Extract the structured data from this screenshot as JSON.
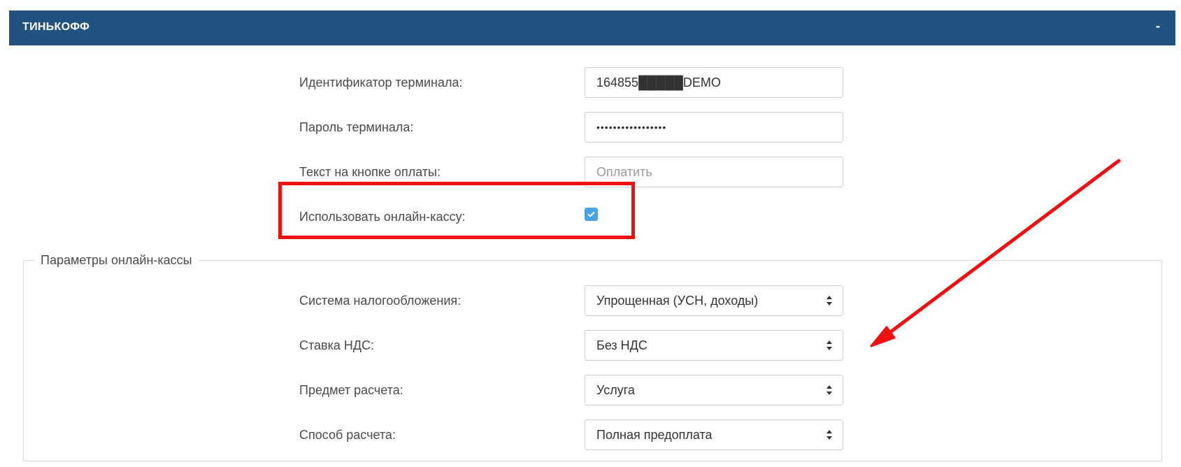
{
  "panel": {
    "title": "ТИНЬКОФФ",
    "toggle_label": "-"
  },
  "terminal": {
    "id_label": "Идентификатор терминала:",
    "id_value": "164855█████DEMO",
    "password_label": "Пароль терминала:",
    "password_value": "•••••••••••••••••",
    "button_text_label": "Текст на кнопке оплаты:",
    "button_text_placeholder": "Оплатить",
    "online_kassa_label": "Использовать онлайн-кассу:",
    "online_kassa_checked": true
  },
  "kassa_params": {
    "legend": "Параметры онлайн-кассы",
    "tax_system_label": "Система налогообложения:",
    "tax_system_value": "Упрощенная (УСН, доходы)",
    "vat_label": "Ставка НДС:",
    "vat_value": "Без НДС",
    "subject_label": "Предмет расчета:",
    "subject_value": "Услуга",
    "method_label": "Способ расчета:",
    "method_value": "Полная предоплата"
  },
  "colors": {
    "header_bg": "#245280",
    "checkbox_accent": "#4aa3e6",
    "annotation_red": "#ee1111"
  },
  "icons": {
    "select_arrows": "up-down-caret-icon",
    "checkbox_check": "checkmark-icon",
    "annotation": "red-arrow-icon"
  }
}
